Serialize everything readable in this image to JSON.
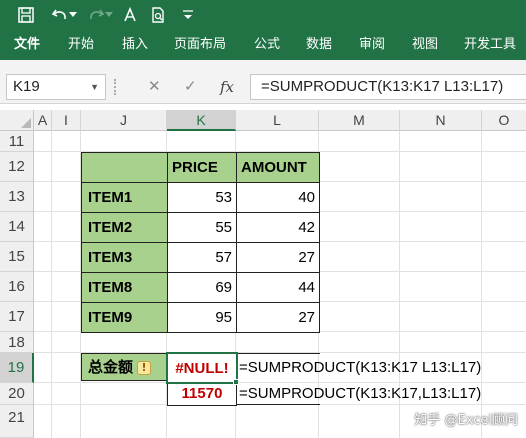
{
  "quick_access": {
    "icons": [
      "save-icon",
      "undo-icon",
      "undo-dropdown-icon",
      "redo-icon",
      "format-painter-icon",
      "print-preview-icon",
      "customize-quick-access-icon"
    ]
  },
  "ribbon": {
    "tabs": [
      "文件",
      "开始",
      "插入",
      "页面布局",
      "公式",
      "数据",
      "审阅",
      "视图",
      "开发工具"
    ]
  },
  "formula_bar": {
    "name_box": "K19",
    "cancel_symbol": "✕",
    "enter_symbol": "✓",
    "fx_symbol": "fx",
    "formula": "=SUMPRODUCT(K13:K17 L13:L17)"
  },
  "columns": [
    "A",
    "I",
    "J",
    "K",
    "L",
    "M",
    "N",
    "O"
  ],
  "rows": [
    "11",
    "12",
    "13",
    "14",
    "15",
    "16",
    "17",
    "18",
    "19",
    "20",
    "21"
  ],
  "table": {
    "headers": [
      "PRICE",
      "AMOUNT"
    ],
    "items": [
      {
        "name": "ITEM1",
        "price": "53",
        "amount": "40"
      },
      {
        "name": "ITEM2",
        "price": "55",
        "amount": "42"
      },
      {
        "name": "ITEM3",
        "price": "57",
        "amount": "27"
      },
      {
        "name": "ITEM8",
        "price": "69",
        "amount": "44"
      },
      {
        "name": "ITEM9",
        "price": "95",
        "amount": "27"
      }
    ]
  },
  "summary": {
    "label": "总金额",
    "warning_symbol": "!",
    "k19_value": "#NULL!",
    "l19_formula": "=SUMPRODUCT(K13:K17 L13:L17)",
    "k20_value": "11570",
    "l20_formula": "=SUMPRODUCT(K13:K17,L13:L17)"
  },
  "watermark": "知乎 @Excel顾问",
  "colors": {
    "excel_green": "#217346",
    "table_fill": "#a9d18e",
    "error_red": "#c00000"
  }
}
